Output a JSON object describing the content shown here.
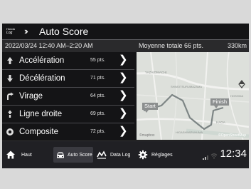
{
  "header": {
    "logo_line1": "Honda",
    "logo_line2": "Log",
    "title": "Auto Score"
  },
  "info": {
    "datetime": "2022/03/24 12:40 AM–2:20 AM",
    "average": "Moyenne totale 66 pts.",
    "distance": "330km"
  },
  "scores": [
    {
      "icon": "acceleration-icon",
      "label": "Accélération",
      "points": "55 pts."
    },
    {
      "icon": "deceleration-icon",
      "label": "Décélération",
      "points": "71 pts."
    },
    {
      "icon": "turn-icon",
      "label": "Virage",
      "points": "64 pts."
    },
    {
      "icon": "straight-line-icon",
      "label": "Ligne droite",
      "points": "69 pts."
    },
    {
      "icon": "composite-icon",
      "label": "Composite",
      "points": "72 pts."
    }
  ],
  "map": {
    "start_label": "Start",
    "finish_label": "Finish",
    "place_labels": [
      "YAZAIOMACHI",
      "SHIMOTSURUMAZAMA",
      "HOSHIDA",
      "HAGA",
      "HIGASHIMIZUNUMA"
    ],
    "attribution": "©mapbox",
    "copyright": "©OpenStreetMap"
  },
  "navbar": {
    "items": [
      {
        "label": "Haut",
        "icon": "home-icon"
      },
      {
        "label": "Auto Score",
        "icon": "car-icon"
      },
      {
        "label": "Data Log",
        "icon": "data-log-icon"
      },
      {
        "label": "Réglages",
        "icon": "settings-gear-icon"
      }
    ],
    "clock": "12:34"
  }
}
